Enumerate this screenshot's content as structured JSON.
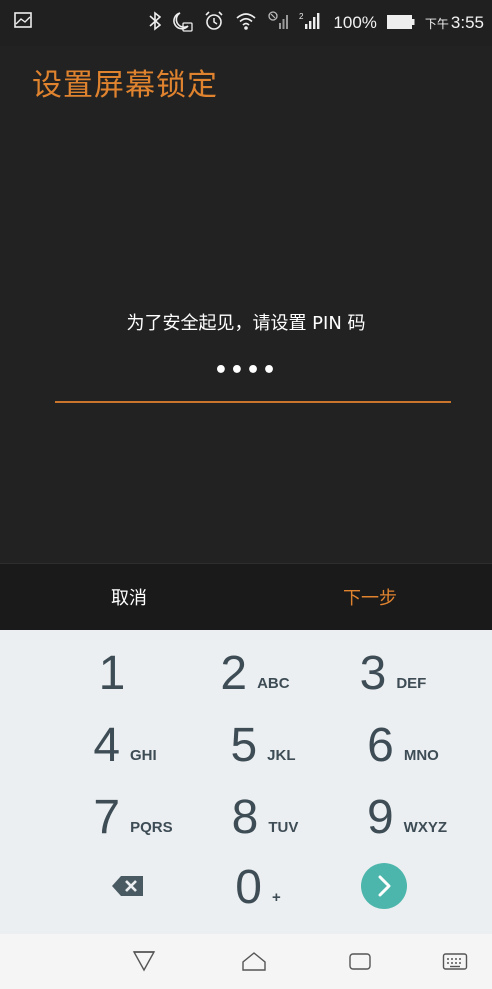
{
  "status_bar": {
    "battery_percent": "100%",
    "time_prefix": "下午",
    "time": "3:55",
    "icons": [
      "gallery-icon",
      "bluetooth-icon",
      "do-not-disturb-icon",
      "alarm-icon",
      "wifi-icon",
      "sim1-signal-icon",
      "sim2-signal-icon",
      "battery-icon"
    ]
  },
  "header": {
    "title": "设置屏幕锁定"
  },
  "pin_entry": {
    "prompt": "为了安全起见，请设置 PIN 码",
    "masked_value": "••••"
  },
  "actions": {
    "cancel_label": "取消",
    "next_label": "下一步"
  },
  "keypad": {
    "keys": [
      {
        "digit": "1",
        "letters": ""
      },
      {
        "digit": "2",
        "letters": "ABC"
      },
      {
        "digit": "3",
        "letters": "DEF"
      },
      {
        "digit": "4",
        "letters": "GHI"
      },
      {
        "digit": "5",
        "letters": "JKL"
      },
      {
        "digit": "6",
        "letters": "MNO"
      },
      {
        "digit": "7",
        "letters": "PQRS"
      },
      {
        "digit": "8",
        "letters": "TUV"
      },
      {
        "digit": "9",
        "letters": "WXYZ"
      },
      {
        "digit": "0",
        "letters": "+"
      }
    ],
    "icons": [
      "backspace-icon",
      "enter-icon"
    ]
  },
  "nav_bar": {
    "icons": [
      "back-icon",
      "home-icon",
      "recents-icon",
      "keyboard-icon"
    ]
  },
  "colors": {
    "accent": "#e0832f",
    "background": "#222222",
    "keypad_bg": "#eceff1",
    "enter_button": "#4db6ac"
  }
}
